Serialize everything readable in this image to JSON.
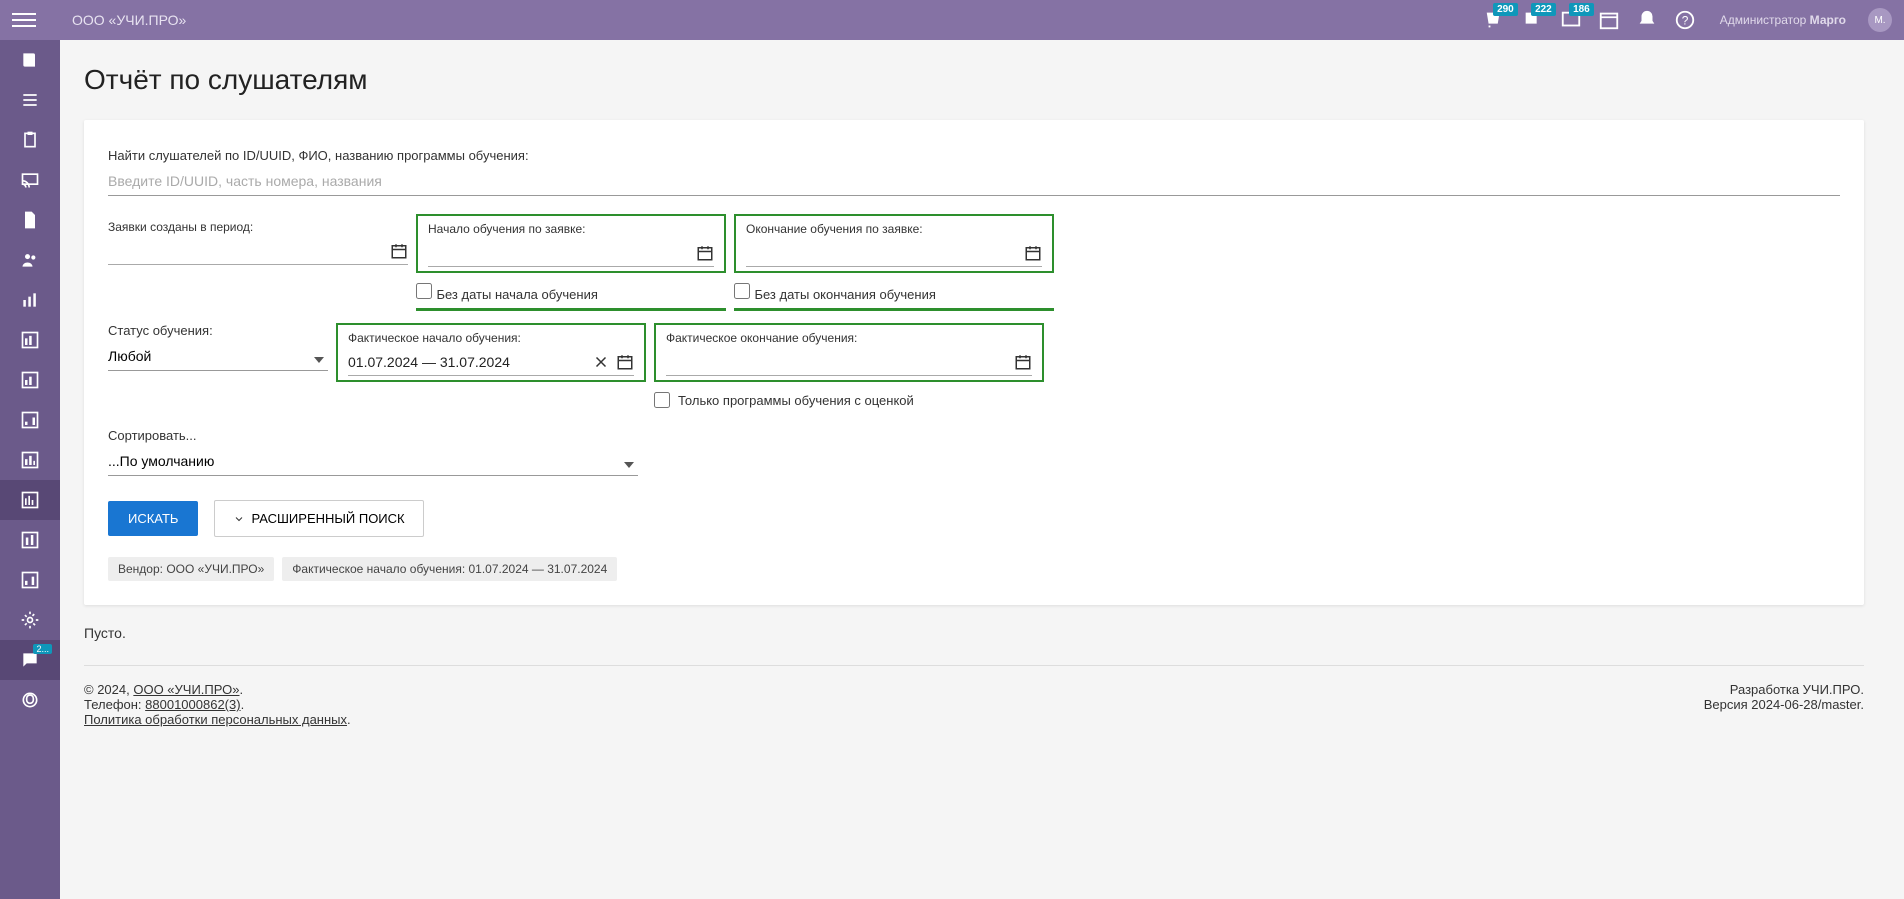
{
  "header": {
    "brand": "ООО «УЧИ.ПРО»",
    "badges": {
      "n1": "290",
      "n2": "222",
      "n3": "186"
    },
    "user_role": "Администратор",
    "user_name": "Марго",
    "avatar_initial": "М."
  },
  "sidebar": {
    "chat_badge": "2..."
  },
  "page": {
    "title": "Отчёт по слушателям",
    "search_label": "Найти слушателей по ID/UUID, ФИО, названию программы обучения:",
    "search_placeholder": "Введите ID/UUID, часть номера, названия",
    "created_label": "Заявки созданы в период:",
    "start_label": "Начало обучения по заявке:",
    "end_label": "Окончание обучения по заявке:",
    "no_start_label": "Без даты начала обучения",
    "no_end_label": "Без даты окончания обучения",
    "status_label": "Статус обучения:",
    "status_value": "Любой",
    "actual_start_label": "Фактическое начало обучения:",
    "actual_start_value": "01.07.2024 — 31.07.2024",
    "actual_end_label": "Фактическое окончание обучения:",
    "only_graded_label": "Только программы обучения с оценкой",
    "sort_label": "Сортировать...",
    "sort_value": "...По умолчанию",
    "search_btn": "ИСКАТЬ",
    "advanced_btn": "РАСШИРЕННЫЙ ПОИСК",
    "chip_vendor": "Вендор: ООО «УЧИ.ПРО»",
    "chip_dates": "Фактическое начало обучения: 01.07.2024 — 31.07.2024",
    "empty": "Пусто."
  },
  "footer": {
    "copyright_prefix": "©  2024, ",
    "copyright_link": "ООО «УЧИ.ПРО»",
    "phone_label": "Телефон: ",
    "phone": "88001000862(3)",
    "policy": "Политика обработки персональных данных",
    "dev": "Разработка УЧИ.ПРО.",
    "version": "Версия 2024-06-28/master."
  }
}
